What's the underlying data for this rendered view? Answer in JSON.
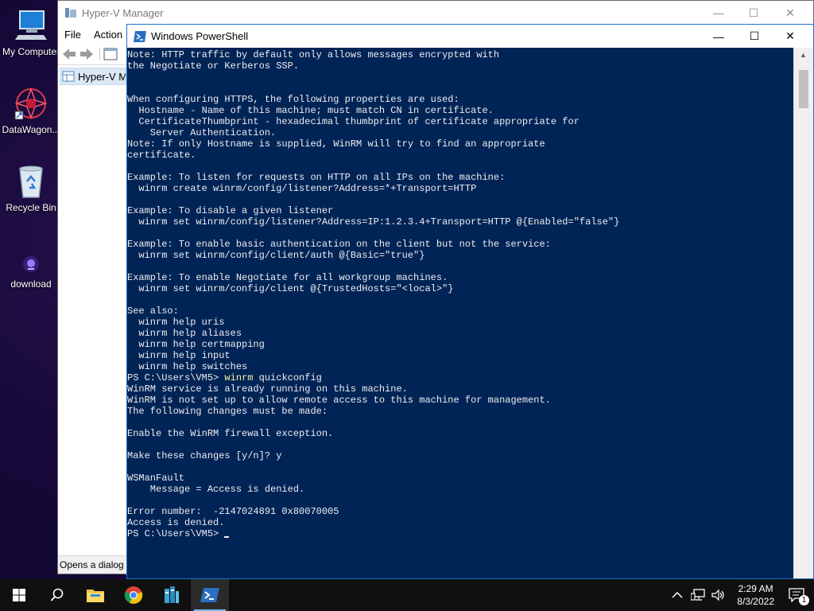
{
  "desktop": {
    "icons": [
      {
        "label": "My Computer"
      },
      {
        "label": "DataWagon..."
      },
      {
        "label": "Recycle Bin"
      },
      {
        "label": "download"
      }
    ]
  },
  "hyperv": {
    "title": "Hyper-V Manager",
    "menu": [
      "File",
      "Action"
    ],
    "tree_node": "Hyper-V Manager",
    "status": "Opens a dialog t"
  },
  "powershell": {
    "title": "Windows PowerShell",
    "lines": [
      "Note: HTTP traffic by default only allows messages encrypted with",
      "the Negotiate or Kerberos SSP.",
      "",
      "",
      "When configuring HTTPS, the following properties are used:",
      "  Hostname - Name of this machine; must match CN in certificate.",
      "  CertificateThumbprint - hexadecimal thumbprint of certificate appropriate for",
      "    Server Authentication.",
      "Note: If only Hostname is supplied, WinRM will try to find an appropriate",
      "certificate.",
      "",
      "Example: To listen for requests on HTTP on all IPs on the machine:",
      "  winrm create winrm/config/listener?Address=*+Transport=HTTP",
      "",
      "Example: To disable a given listener",
      "  winrm set winrm/config/listener?Address=IP:1.2.3.4+Transport=HTTP @{Enabled=\"false\"}",
      "",
      "Example: To enable basic authentication on the client but not the service:",
      "  winrm set winrm/config/client/auth @{Basic=\"true\"}",
      "",
      "Example: To enable Negotiate for all workgroup machines.",
      "  winrm set winrm/config/client @{TrustedHosts=\"<local>\"}",
      "",
      "See also:",
      "  winrm help uris",
      "  winrm help aliases",
      "  winrm help certmapping",
      "  winrm help input",
      "  winrm help switches"
    ],
    "prompt_cmd": {
      "prompt": "PS C:\\Users\\VM5> ",
      "cmd": "winrm",
      "args": " quickconfig"
    },
    "lines_after": [
      "WinRM service is already running on this machine.",
      "WinRM is not set up to allow remote access to this machine for management.",
      "The following changes must be made:",
      "",
      "Enable the WinRM firewall exception.",
      "",
      "Make these changes [y/n]? y",
      "",
      "WSManFault",
      "    Message = Access is denied.",
      "",
      "Error number:  -2147024891 0x80070005",
      "Access is denied."
    ],
    "final_prompt": "PS C:\\Users\\VM5> "
  },
  "taskbar": {
    "apps": [
      "start-icon",
      "search-icon",
      "file-explorer-icon",
      "chrome-icon",
      "server-manager-icon",
      "powershell-icon"
    ],
    "time": "2:29 AM",
    "date": "8/3/2022",
    "notification_count": "1"
  },
  "colors": {
    "ps_bg": "#012456",
    "ps_text": "#eeedf0",
    "ps_cmd": "#f9f1a5",
    "taskbar": "#101010"
  }
}
